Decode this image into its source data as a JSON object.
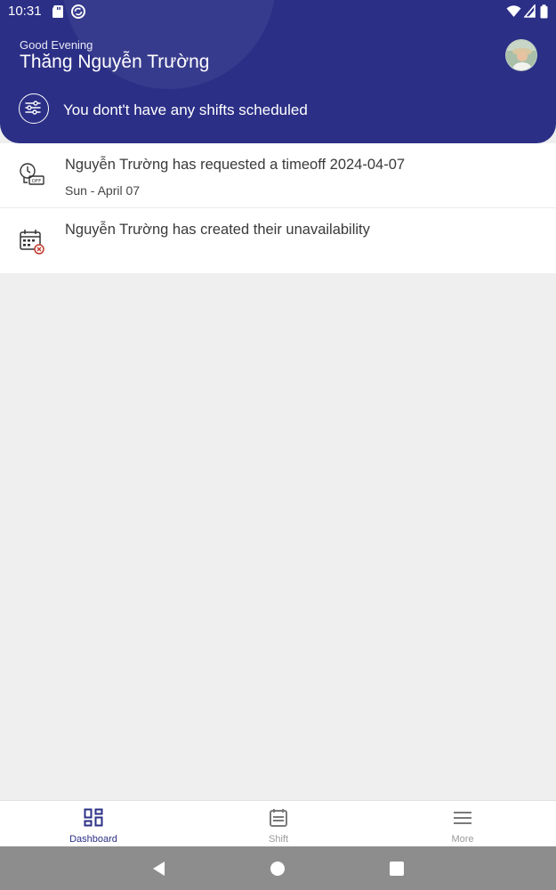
{
  "status_bar": {
    "time": "10:31"
  },
  "header": {
    "greeting": "Good Evening",
    "user_name": "Thăng Nguyễn Trường",
    "shift_message": "You dont't have any shifts scheduled",
    "background_color": "#2b2f86"
  },
  "activities": [
    {
      "icon": "timeoff-icon",
      "title": "Nguyễn Trường has requested a timeoff 2024-04-07",
      "subtitle": "Sun - April 07"
    },
    {
      "icon": "calendar-unavailable-icon",
      "title": "Nguyễn Trường has created their unavailability",
      "subtitle": ""
    }
  ],
  "bottom_nav": {
    "items": [
      {
        "label": "Dashboard",
        "icon": "dashboard-icon",
        "active": true
      },
      {
        "label": "Shift",
        "icon": "calendar-icon",
        "active": false
      },
      {
        "label": "More",
        "icon": "menu-icon",
        "active": false
      }
    ],
    "active_color": "#2b2f86",
    "inactive_color": "#9a9a9a"
  },
  "system_nav": {
    "buttons": [
      "back",
      "home",
      "recents"
    ]
  }
}
